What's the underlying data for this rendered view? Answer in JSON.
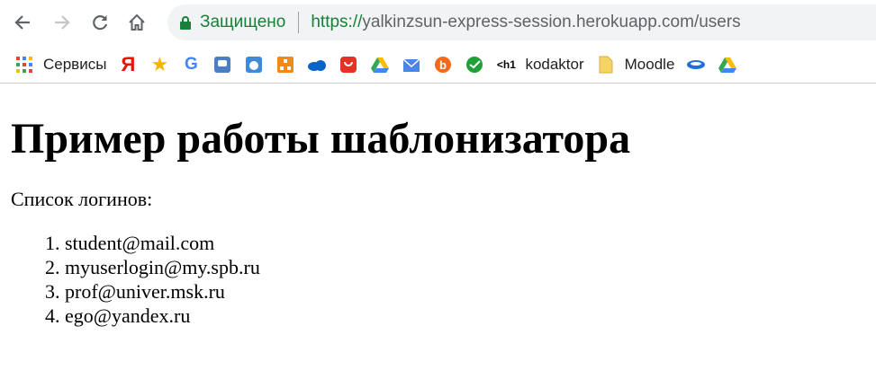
{
  "browser": {
    "secure_label": "Защищено",
    "url_scheme": "https://",
    "url_host": "yalkinzsun-express-session.herokuapp.com",
    "url_path": "/users"
  },
  "bookmarks": [
    {
      "icon": "apps-grid-icon",
      "label": "Сервисы"
    },
    {
      "icon": "yandex-icon",
      "label": ""
    },
    {
      "icon": "star-icon",
      "label": ""
    },
    {
      "icon": "google-icon",
      "label": ""
    },
    {
      "icon": "chat-icon",
      "label": ""
    },
    {
      "icon": "cloud-sync-icon",
      "label": ""
    },
    {
      "icon": "network-icon",
      "label": ""
    },
    {
      "icon": "onedrive-icon",
      "label": ""
    },
    {
      "icon": "aliexpress-icon",
      "label": ""
    },
    {
      "icon": "drive-icon",
      "label": ""
    },
    {
      "icon": "mail-icon",
      "label": ""
    },
    {
      "icon": "b-icon",
      "label": ""
    },
    {
      "icon": "sberbank-icon",
      "label": ""
    },
    {
      "icon": "h1-icon",
      "label": "kodaktor"
    },
    {
      "icon": "folder-icon",
      "label": "Moodle"
    },
    {
      "icon": "disk-icon",
      "label": ""
    },
    {
      "icon": "drive-icon-2",
      "label": ""
    }
  ],
  "page": {
    "heading": "Пример работы шаблонизатора",
    "intro": "Список логинов:",
    "logins": [
      "student@mail.com",
      "myuserlogin@my.spb.ru",
      "prof@univer.msk.ru",
      "ego@yandex.ru"
    ]
  }
}
